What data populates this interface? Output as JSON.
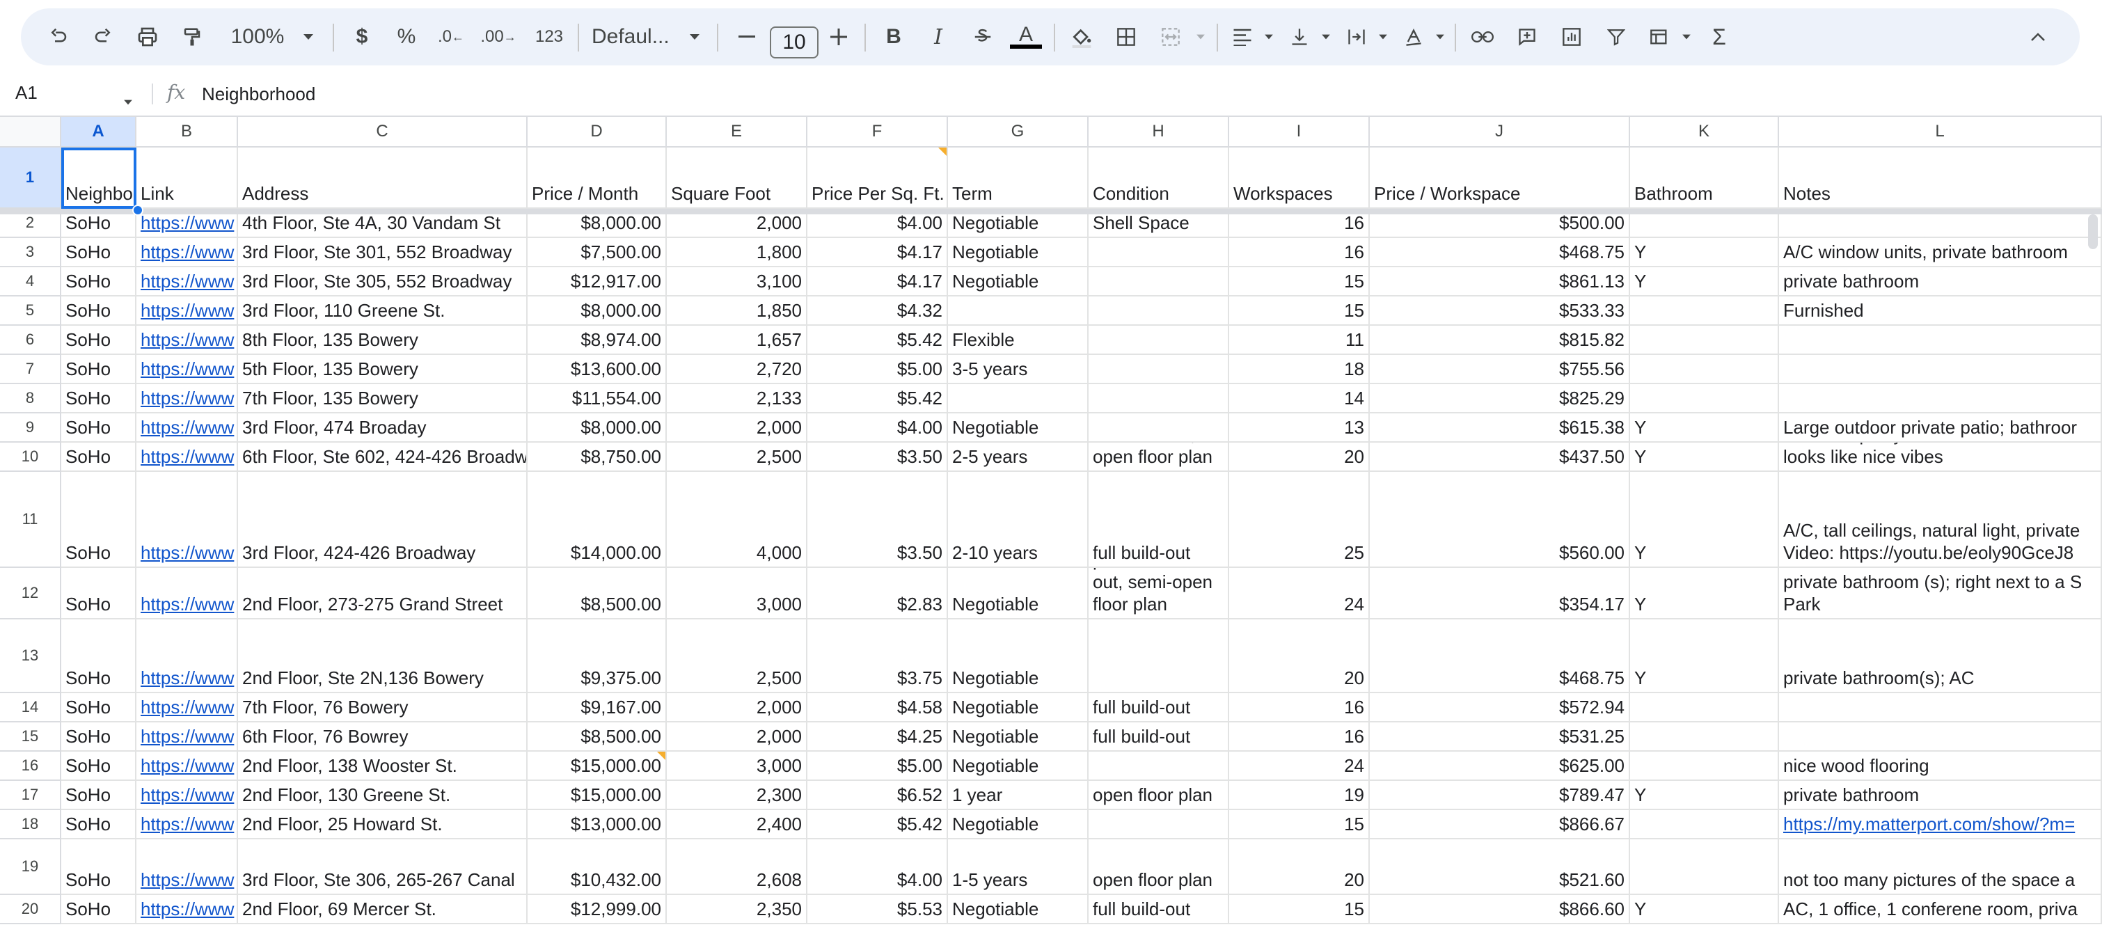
{
  "toolbar": {
    "zoom": "100%",
    "currency_label": "$",
    "percent_label": "%",
    "decrease_decimal_label": ".0",
    "increase_decimal_label": ".00",
    "number_format_label": "123",
    "font_name": "Defaul...",
    "font_size": "10",
    "bold_label": "B",
    "italic_label": "I",
    "text_color_label": "A",
    "text_color": "#000000",
    "sum_label": "Σ"
  },
  "formula_bar": {
    "cell_ref": "A1",
    "fx_label": "fx",
    "value": "Neighborhood"
  },
  "columns": [
    "A",
    "B",
    "C",
    "D",
    "E",
    "F",
    "G",
    "H",
    "I",
    "J",
    "K",
    "L"
  ],
  "headers": [
    "Neighborhood",
    "Link",
    "Address",
    "Price / Month",
    "Square Foot",
    "Price Per Sq. Ft.",
    "Term",
    "Condition",
    "Workspaces",
    "Price / Workspace",
    "Bathroom",
    "Notes"
  ],
  "rows": [
    {
      "n": "2",
      "cells": [
        "SoHo",
        "https://www",
        "4th Floor, Ste 4A, 30 Vandam St",
        "$8,000.00",
        "2,000",
        "$4.00",
        "Negotiable",
        "Shell Space",
        "16",
        "$500.00",
        "",
        ""
      ]
    },
    {
      "n": "3",
      "cells": [
        "SoHo",
        "https://www",
        "3rd Floor, Ste 301, 552 Broadway",
        "$7,500.00",
        "1,800",
        "$4.17",
        "Negotiable",
        "",
        "16",
        "$468.75",
        "Y",
        "A/C window units, private bathroom"
      ]
    },
    {
      "n": "4",
      "cells": [
        "SoHo",
        "https://www",
        "3rd Floor, Ste 305, 552 Broadway",
        "$12,917.00",
        "3,100",
        "$4.17",
        "Negotiable",
        "",
        "15",
        "$861.13",
        "Y",
        "private bathroom"
      ]
    },
    {
      "n": "5",
      "cells": [
        "SoHo",
        "https://www",
        "3rd Floor, 110 Greene St.",
        "$8,000.00",
        "1,850",
        "$4.32",
        "",
        "",
        "15",
        "$533.33",
        "",
        "Furnished"
      ]
    },
    {
      "n": "6",
      "cells": [
        "SoHo",
        "https://www",
        "8th Floor, 135 Bowery",
        "$8,974.00",
        "1,657",
        "$5.42",
        "Flexible",
        "",
        "11",
        "$815.82",
        "",
        ""
      ]
    },
    {
      "n": "7",
      "cells": [
        "SoHo",
        "https://www",
        "5th Floor, 135 Bowery",
        "$13,600.00",
        "2,720",
        "$5.00",
        "3-5 years",
        "",
        "18",
        "$755.56",
        "",
        ""
      ]
    },
    {
      "n": "8",
      "cells": [
        "SoHo",
        "https://www",
        "7th Floor, 135 Bowery",
        "$11,554.00",
        "2,133",
        "$5.42",
        "",
        "",
        "14",
        "$825.29",
        "",
        ""
      ]
    },
    {
      "n": "9",
      "cells": [
        "SoHo",
        "https://www",
        "3rd Floor, 474 Broaday",
        "$8,000.00",
        "2,000",
        "$4.00",
        "Negotiable",
        "",
        "13",
        "$615.38",
        "Y",
        "Large outdoor private patio; bathroor"
      ]
    },
    {
      "n": "10",
      "cells": [
        "SoHo",
        "https://www",
        "6th Floor, Ste 602, 424-426 Broadw",
        "$8,750.00",
        "2,500",
        "$3.50",
        "2-5 years",
        "full build-out,\nopen floor plan",
        "20",
        "$437.50",
        "Y",
        "A/C, tall ceilings, natural light, private\nsemi-furnished\nVideo: https://youtu.be/kOdZWea4W\nlooks like nice vibes"
      ]
    },
    {
      "n": "11",
      "cells": [
        "SoHo",
        "https://www",
        "3rd Floor, 424-426 Broadway",
        "$14,000.00",
        "4,000",
        "$3.50",
        "2-10 years",
        "full build-out",
        "25",
        "$560.00",
        "Y",
        "A/C, tall ceilings, natural light, private\nVideo: https://youtu.be/eoly90GceJ8"
      ]
    },
    {
      "n": "12",
      "cells": [
        "SoHo",
        "https://www",
        "2nd Floor, 273-275 Grand Street",
        "$8,500.00",
        "3,000",
        "$2.83",
        "Negotiable",
        "partial build\nout, semi-open\nfloor plan",
        "24",
        "$354.17",
        "Y",
        "private bathroom (s); right next to a S\nPark"
      ]
    },
    {
      "n": "13",
      "cells": [
        "SoHo",
        "https://www",
        "2nd Floor, Ste 2N,136 Bowery",
        "$9,375.00",
        "2,500",
        "$3.75",
        "Negotiable",
        "",
        "20",
        "$468.75",
        "Y",
        "private bathroom(s); AC"
      ]
    },
    {
      "n": "14",
      "cells": [
        "SoHo",
        "https://www",
        "7th Floor, 76 Bowery",
        "$9,167.00",
        "2,000",
        "$4.58",
        "Negotiable",
        "full build-out",
        "16",
        "$572.94",
        "",
        ""
      ]
    },
    {
      "n": "15",
      "cells": [
        "SoHo",
        "https://www",
        "6th Floor, 76 Bowrey",
        "$8,500.00",
        "2,000",
        "$4.25",
        "Negotiable",
        "full build-out",
        "16",
        "$531.25",
        "",
        ""
      ]
    },
    {
      "n": "16",
      "cells": [
        "SoHo",
        "https://www",
        "2nd Floor, 138 Wooster St.",
        "$15,000.00",
        "3,000",
        "$5.00",
        "Negotiable",
        "",
        "24",
        "$625.00",
        "",
        "nice wood flooring"
      ]
    },
    {
      "n": "17",
      "cells": [
        "SoHo",
        "https://www",
        "2nd Floor, 130 Greene St.",
        "$15,000.00",
        "2,300",
        "$6.52",
        "1 year",
        "open floor plan",
        "19",
        "$789.47",
        "Y",
        "private bathroom"
      ]
    },
    {
      "n": "18",
      "cells": [
        "SoHo",
        "https://www",
        "2nd Floor, 25 Howard St.",
        "$13,000.00",
        "2,400",
        "$5.42",
        "Negotiable",
        "",
        "15",
        "$866.67",
        "",
        "virtual tour:\nhttps://my.matterport.com/show/?m="
      ]
    },
    {
      "n": "19",
      "cells": [
        "SoHo",
        "https://www",
        "3rd Floor, Ste 306, 265-267 Canal",
        "$10,432.00",
        "2,608",
        "$4.00",
        "1-5 years",
        "open floor plan",
        "20",
        "$521.60",
        "",
        "not too many pictures of the space a"
      ]
    },
    {
      "n": "20",
      "cells": [
        "SoHo",
        "https://www",
        "2nd Floor, 69 Mercer St.",
        "$12,999.00",
        "2,350",
        "$5.53",
        "Negotiable",
        "full build-out",
        "15",
        "$866.60",
        "Y",
        "AC, 1 office, 1 conferene room, priva"
      ]
    }
  ]
}
